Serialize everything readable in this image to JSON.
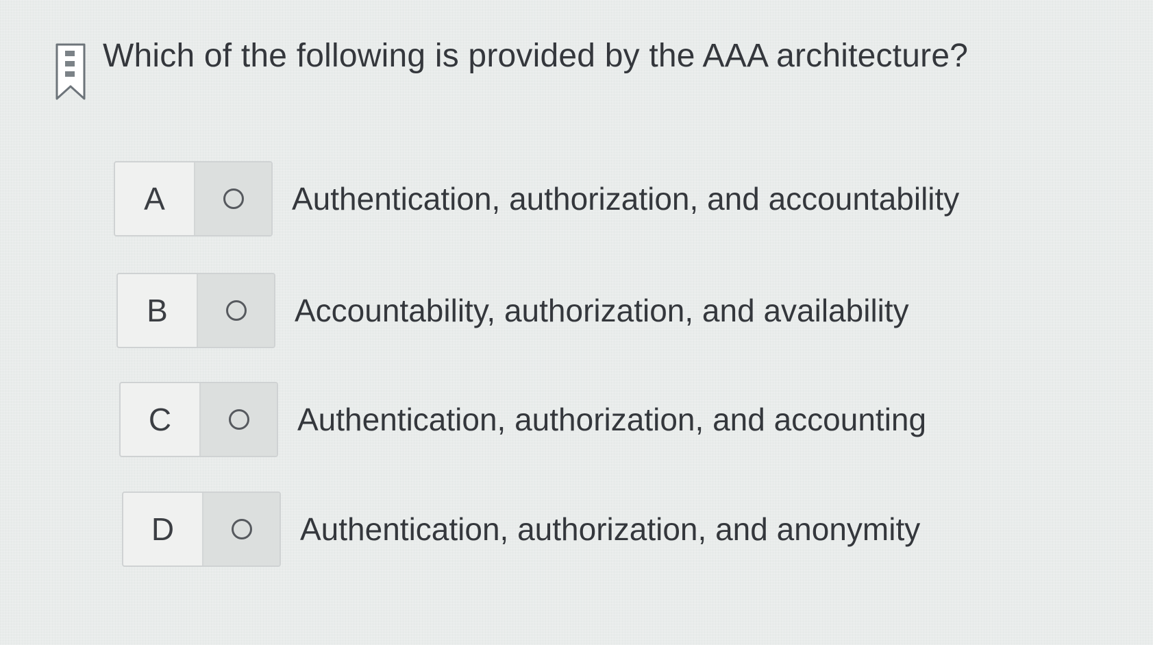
{
  "question": {
    "text": "Which of the following is provided by the AAA architecture?"
  },
  "options": [
    {
      "letter": "A",
      "text": "Authentication, authorization, and accountability"
    },
    {
      "letter": "B",
      "text": "Accountability, authorization, and availability"
    },
    {
      "letter": "C",
      "text": "Authentication, authorization, and accounting"
    },
    {
      "letter": "D",
      "text": "Authentication, authorization, and anonymity"
    }
  ],
  "icons": {
    "bookmark": "bookmark-icon",
    "radio": "radio-unselected-icon"
  },
  "colors": {
    "background": "#e9eceb",
    "text": "#34373c",
    "radio_panel": "#dcdfde",
    "border": "#cfd2d3"
  }
}
